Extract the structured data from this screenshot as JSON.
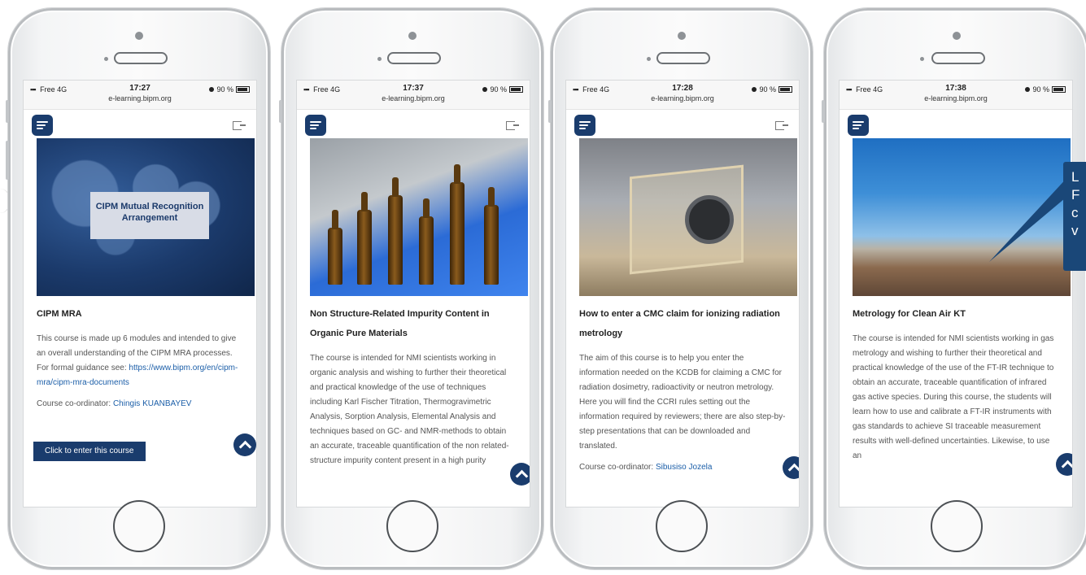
{
  "status_bar": {
    "carrier": "Free",
    "network": "4G",
    "url": "e-learning.bipm.org",
    "battery": "90 %"
  },
  "phones": [
    {
      "time": "17:27",
      "image_label": "CIPM Mutual Recognition Arrangement",
      "title": "CIPM MRA",
      "description": "This course is made up 6 modules and intended to give an overall understanding of the CIPM MRA processes. For formal guidance see: ",
      "link": "https://www.bipm.org/en/cipm-mra/cipm-mra-documents",
      "coordinator_label": "Course co-ordinator: ",
      "coordinator": "Chingis KUANBAYEV",
      "enter_button": "Click to enter this course"
    },
    {
      "time": "17:37",
      "title": "Non Structure-Related Impurity Content in Organic Pure Materials",
      "description": "The course is intended for NMI scientists working in organic analysis and wishing to further their theoretical and practical knowledge of the use of techniques including Karl Fischer Titration, Thermogravimetric Analysis, Sorption Analysis, Elemental Analysis and techniques based on GC- and NMR-methods to obtain an accurate, traceable quantification of the non related-structure impurity content present in a high purity"
    },
    {
      "time": "17:28",
      "title": "How to enter a CMC claim for ionizing radiation metrology",
      "description": "The aim of this course is to help you enter the information needed on the KCDB for claiming a CMC for radiation dosimetry, radioactivity or neutron metrology. Here you will find the CCRI rules setting out the information required by reviewers; there are also step-by-step presentations that can be downloaded and translated.",
      "coordinator_label": "Course co-ordinator: ",
      "coordinator": "Sibusiso Jozela"
    },
    {
      "time": "17:38",
      "title": "Metrology for Clean Air KT",
      "description": "The course is intended for NMI scientists working in gas metrology and wishing to further their theoretical and practical knowledge of the use of the FT-IR technique to obtain an accurate, traceable quantification of infrared gas active species. During this course, the students will learn how to use and calibrate a FT-IR instruments with gas standards to achieve SI traceable measurement results with well-defined uncertainties. Likewise, to use an"
    }
  ],
  "callout": {
    "lines": [
      "L",
      "F",
      "c",
      "v"
    ]
  },
  "colors": {
    "brand_navy": "#1a3c6d",
    "link_blue": "#1b5ea8",
    "callout_blue": "#1a4778"
  }
}
